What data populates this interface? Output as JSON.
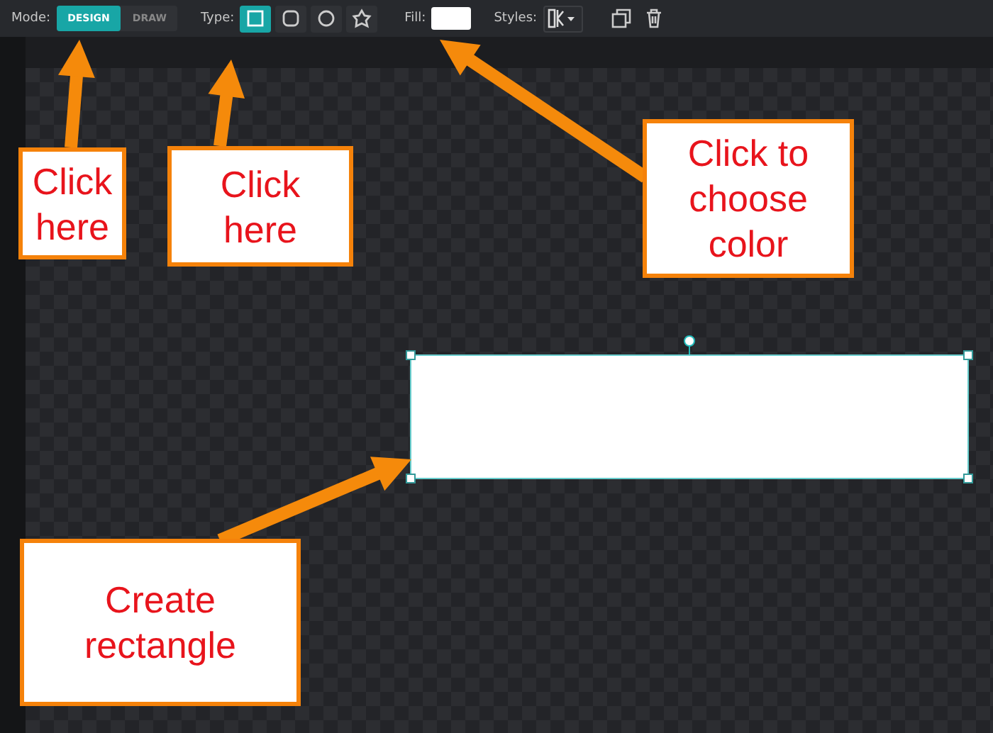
{
  "toolbar": {
    "mode_label": "Mode:",
    "modes": [
      {
        "label": "DESIGN",
        "selected": true
      },
      {
        "label": "DRAW",
        "selected": false
      }
    ],
    "type_label": "Type:",
    "types": [
      {
        "kind": "square",
        "selected": true
      },
      {
        "kind": "rounded",
        "selected": false
      },
      {
        "kind": "circle",
        "selected": false
      },
      {
        "kind": "custom",
        "selected": false
      }
    ],
    "fill_label": "Fill:",
    "styles_label": "Styles:"
  },
  "callouts": [
    {
      "text": "Click here"
    },
    {
      "text": "Click here"
    },
    {
      "text": "Click to choose color"
    },
    {
      "text": "Create rectangle"
    }
  ]
}
